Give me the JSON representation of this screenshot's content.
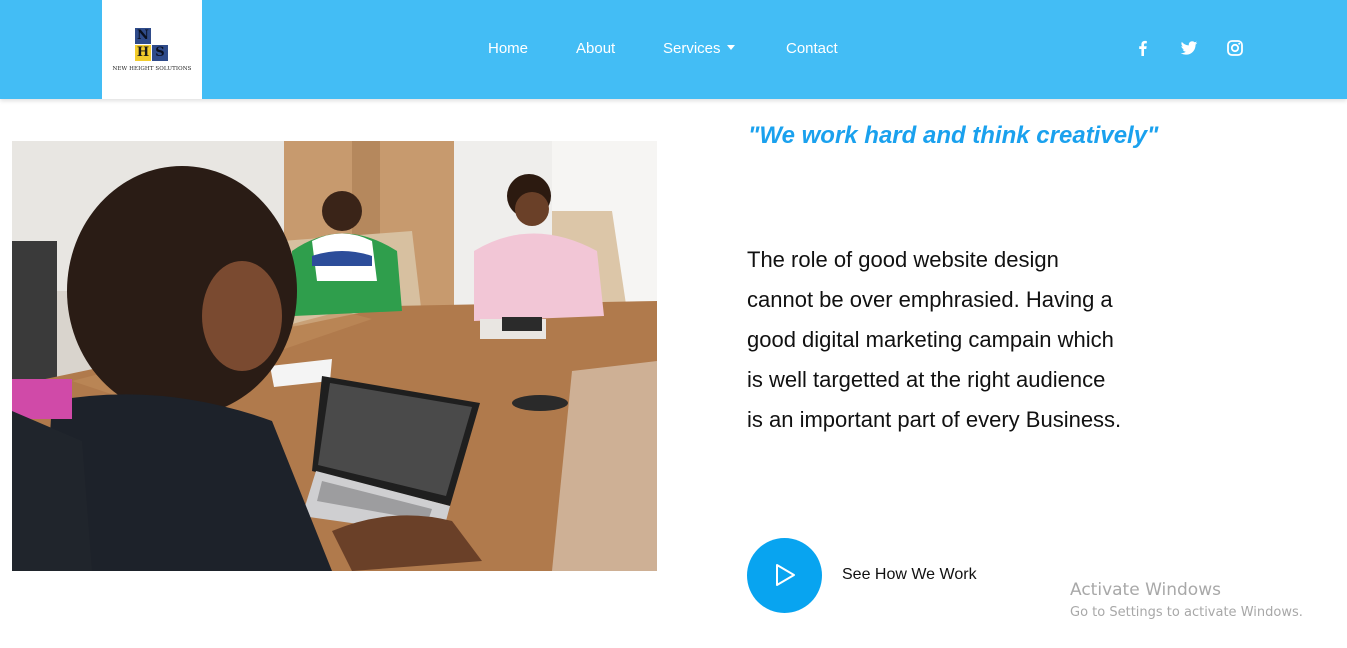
{
  "logo": {
    "letters": [
      "N",
      "H",
      "S"
    ],
    "text": "NEW HEIGHT SOLUTIONS"
  },
  "nav": {
    "home": "Home",
    "about": "About",
    "services": "Services",
    "contact": "Contact"
  },
  "social_icons": [
    "facebook-icon",
    "twitter-icon",
    "instagram-icon"
  ],
  "hero": {
    "quote": "\"We work hard and think creatively\"",
    "body": "The role of good website design cannot be over emphrasied. Having a good digital marketing campain which is well targetted at the right audience is an important part of every Business.",
    "cta_label": "See How We Work"
  },
  "windows_watermark": {
    "title": "Activate Windows",
    "subtitle": "Go to Settings to activate Windows."
  },
  "colors": {
    "navbar": "#43bdf5",
    "quote": "#1aa1ee",
    "play_button": "#08a4f0"
  }
}
